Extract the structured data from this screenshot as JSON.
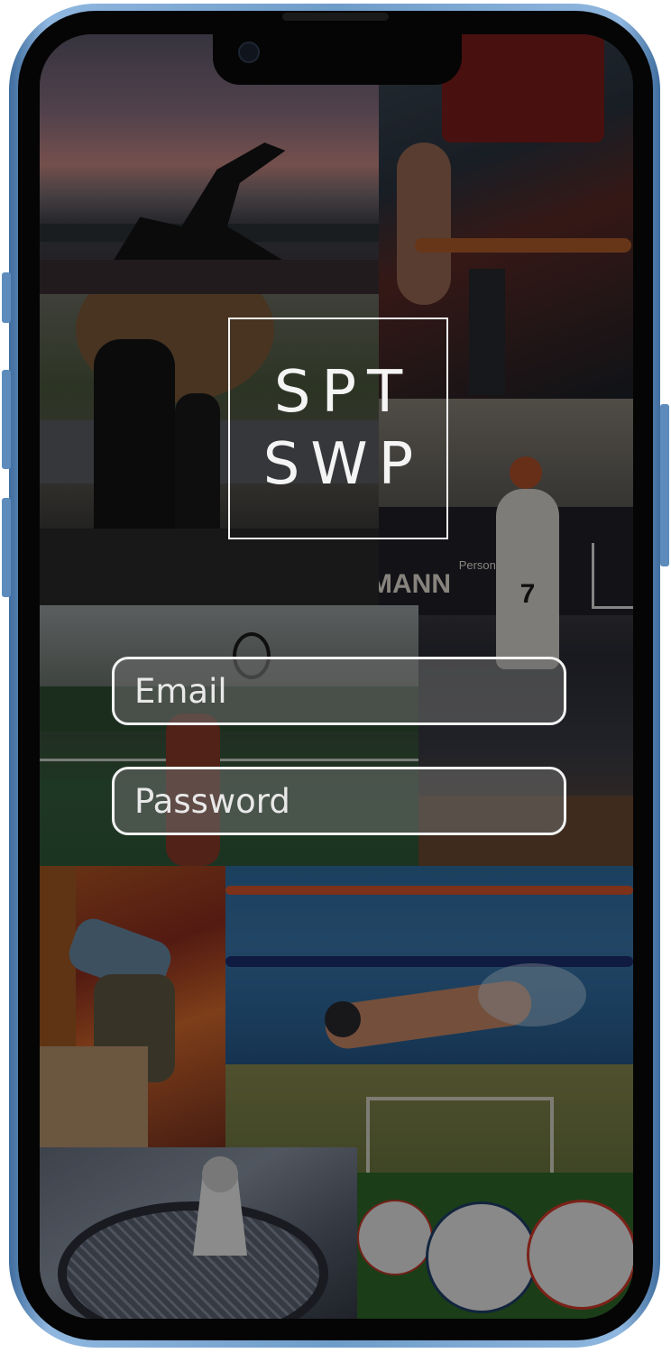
{
  "logo": {
    "line1": "SPT",
    "line2": "SWP"
  },
  "login_form": {
    "email": {
      "placeholder": "Email",
      "value": ""
    },
    "password": {
      "placeholder": "Password",
      "value": ""
    }
  },
  "background": {
    "collage_photos": [
      "yoga",
      "cycling",
      "running",
      "basketball",
      "tennis",
      "climbing",
      "swimming",
      "soccer",
      "badminton"
    ]
  },
  "visible_signage": {
    "sign_small": "Personal",
    "sign_brand": "MANN",
    "jersey_number": "7"
  },
  "colors": {
    "frame": "#6e9cc9",
    "field_border": "#f2f2f2",
    "logo": "#f4f4f4"
  }
}
